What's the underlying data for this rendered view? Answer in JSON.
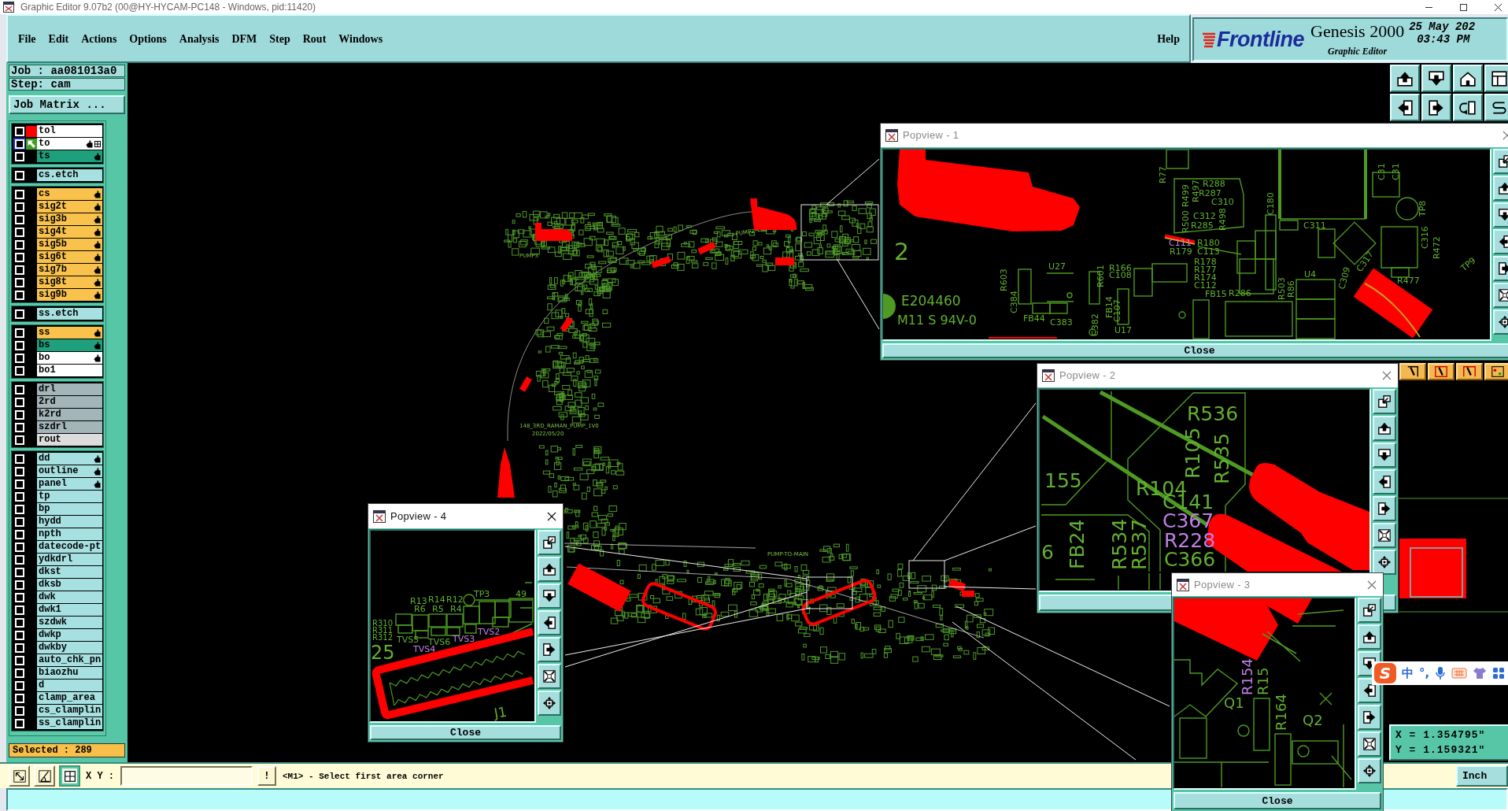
{
  "window": {
    "title": "Graphic Editor 9.07b2 (00@HY-HYCAM-PC148 - Windows, pid:11420)"
  },
  "menu": {
    "items": [
      "File",
      "Edit",
      "Actions",
      "Options",
      "Analysis",
      "DFM",
      "Step",
      "Rout",
      "Windows"
    ],
    "help": "Help"
  },
  "brand": {
    "logo": "Frontline",
    "product": "Genesis 2000",
    "subtitle": "Graphic Editor",
    "date": "25 May 202",
    "time": "03:43 PM"
  },
  "job_panel": {
    "job": "Job : aa081013a0",
    "step": "Step: cam",
    "matrix_button": "Job Matrix ..."
  },
  "layer_groups": [
    {
      "layers": [
        {
          "name": "tol",
          "kind": "silk_screen",
          "color": "#ff0000",
          "work": false,
          "checked": false,
          "affected": false
        },
        {
          "name": "to",
          "kind": "silk_screen",
          "color": "#3f9f22",
          "work": true,
          "checked": false,
          "affected": true
        },
        {
          "name": "ts",
          "kind": "solder_mask",
          "work": false,
          "checked": false,
          "affected": true
        }
      ]
    },
    {
      "layers": [
        {
          "name": "cs.etch",
          "kind": "document",
          "work": false,
          "checked": false,
          "affected": false
        }
      ]
    },
    {
      "layers": [
        {
          "name": "cs",
          "kind": "signal",
          "work": false,
          "checked": false,
          "affected": true
        },
        {
          "name": "sig2t",
          "kind": "signal",
          "work": false,
          "checked": false,
          "affected": true
        },
        {
          "name": "sig3b",
          "kind": "signal",
          "work": false,
          "checked": false,
          "affected": true
        },
        {
          "name": "sig4t",
          "kind": "signal",
          "work": false,
          "checked": false,
          "affected": true
        },
        {
          "name": "sig5b",
          "kind": "signal",
          "work": false,
          "checked": false,
          "affected": true
        },
        {
          "name": "sig6t",
          "kind": "signal",
          "work": false,
          "checked": false,
          "affected": true
        },
        {
          "name": "sig7b",
          "kind": "signal",
          "work": false,
          "checked": false,
          "affected": true
        },
        {
          "name": "sig8t",
          "kind": "signal",
          "work": false,
          "checked": false,
          "affected": true
        },
        {
          "name": "sig9b",
          "kind": "signal",
          "work": false,
          "checked": false,
          "affected": true
        }
      ]
    },
    {
      "layers": [
        {
          "name": "ss.etch",
          "kind": "document",
          "work": false,
          "checked": false,
          "affected": false
        }
      ]
    },
    {
      "layers": [
        {
          "name": "ss",
          "kind": "signal",
          "work": false,
          "checked": false,
          "affected": true
        },
        {
          "name": "bs",
          "kind": "solder_mask",
          "work": false,
          "checked": false,
          "affected": true
        },
        {
          "name": "bo",
          "kind": "silk_screen",
          "work": false,
          "checked": false,
          "affected": true
        },
        {
          "name": "bo1",
          "kind": "silk_screen",
          "work": false,
          "checked": false,
          "affected": false
        }
      ]
    },
    {
      "layers": [
        {
          "name": "drl",
          "kind": "drill",
          "work": false,
          "checked": false,
          "affected": false
        },
        {
          "name": "2rd",
          "kind": "drill",
          "work": false,
          "checked": false,
          "affected": false
        },
        {
          "name": "k2rd",
          "kind": "drill",
          "work": false,
          "checked": false,
          "affected": false
        },
        {
          "name": "szdrl",
          "kind": "drill",
          "work": false,
          "checked": false,
          "affected": false
        },
        {
          "name": "rout",
          "kind": "rout",
          "work": false,
          "checked": false,
          "affected": false
        }
      ]
    },
    {
      "layers": [
        {
          "name": "dd",
          "kind": "document",
          "work": false,
          "checked": false,
          "affected": true
        },
        {
          "name": "outline",
          "kind": "document",
          "work": false,
          "checked": false,
          "affected": true
        },
        {
          "name": "panel",
          "kind": "document",
          "work": false,
          "checked": false,
          "affected": true
        },
        {
          "name": "tp",
          "kind": "document",
          "work": false,
          "checked": false,
          "affected": false
        },
        {
          "name": "bp",
          "kind": "document",
          "work": false,
          "checked": false,
          "affected": false
        },
        {
          "name": "hydd",
          "kind": "document",
          "work": false,
          "checked": false,
          "affected": false
        },
        {
          "name": "npth",
          "kind": "document",
          "work": false,
          "checked": false,
          "affected": false
        },
        {
          "name": "datecode-pt",
          "kind": "document",
          "work": false,
          "checked": false,
          "affected": false
        },
        {
          "name": "ydkdrl",
          "kind": "document",
          "work": false,
          "checked": false,
          "affected": false
        },
        {
          "name": "dkst",
          "kind": "document",
          "work": false,
          "checked": false,
          "affected": false
        },
        {
          "name": "dksb",
          "kind": "document",
          "work": false,
          "checked": false,
          "affected": false
        },
        {
          "name": "dwk",
          "kind": "document",
          "work": false,
          "checked": false,
          "affected": false
        },
        {
          "name": "dwk1",
          "kind": "document",
          "work": false,
          "checked": false,
          "affected": false
        },
        {
          "name": "szdwk",
          "kind": "document",
          "work": false,
          "checked": false,
          "affected": false
        },
        {
          "name": "dwkp",
          "kind": "document",
          "work": false,
          "checked": false,
          "affected": false
        },
        {
          "name": "dwkby",
          "kind": "document",
          "work": false,
          "checked": false,
          "affected": false
        },
        {
          "name": "auto_chk_pn",
          "kind": "document",
          "work": false,
          "checked": false,
          "affected": false
        },
        {
          "name": "biaozhu",
          "kind": "document",
          "work": false,
          "checked": false,
          "affected": false
        },
        {
          "name": "d",
          "kind": "document",
          "work": false,
          "checked": false,
          "affected": false
        },
        {
          "name": "clamp_area",
          "kind": "document",
          "work": false,
          "checked": false,
          "affected": false
        },
        {
          "name": "cs_clamplin",
          "kind": "document",
          "work": false,
          "checked": false,
          "affected": false
        },
        {
          "name": "ss_clamplin",
          "kind": "document",
          "work": false,
          "checked": false,
          "affected": false
        }
      ]
    }
  ],
  "selection": "Selected : 289",
  "canvas": {
    "labels": [
      "PUMP2",
      "PUMP3",
      "148_3RD_RAMAN_PUMP_1V0",
      "2022/05/20",
      "PUMP-TO-MAIN"
    ]
  },
  "popviews": [
    {
      "title": "Popview - 1",
      "active": false,
      "close_label": "Close",
      "labels": [
        {
          "text": "2",
          "highlighted": false
        },
        {
          "text": "E204460",
          "highlighted": false
        },
        {
          "text": "M11 S 94V-0",
          "highlighted": false
        },
        {
          "text": "R77",
          "highlighted": false
        },
        {
          "text": "R499",
          "highlighted": false
        },
        {
          "text": "R288",
          "highlighted": false
        },
        {
          "text": "R497",
          "highlighted": false
        },
        {
          "text": "R287",
          "highlighted": false
        },
        {
          "text": "C310",
          "highlighted": false
        },
        {
          "text": "R500",
          "highlighted": false
        },
        {
          "text": "C312",
          "highlighted": false
        },
        {
          "text": "R498",
          "highlighted": false
        },
        {
          "text": "R285",
          "highlighted": false
        },
        {
          "text": "C180",
          "highlighted": false
        },
        {
          "text": "C311",
          "highlighted": false
        },
        {
          "text": "C31",
          "highlighted": false
        },
        {
          "text": "C31",
          "highlighted": false
        },
        {
          "text": "TP8",
          "highlighted": false
        },
        {
          "text": "C316",
          "highlighted": false
        },
        {
          "text": "R472",
          "highlighted": false
        },
        {
          "text": "C317",
          "highlighted": false
        },
        {
          "text": "R477",
          "highlighted": false
        },
        {
          "text": "TP9",
          "highlighted": false
        },
        {
          "text": "U27",
          "highlighted": false
        },
        {
          "text": "R603",
          "highlighted": false
        },
        {
          "text": "C384",
          "highlighted": false
        },
        {
          "text": "FB44",
          "highlighted": false
        },
        {
          "text": "C383",
          "highlighted": false
        },
        {
          "text": "R166",
          "highlighted": false
        },
        {
          "text": "C108",
          "highlighted": false
        },
        {
          "text": "R601",
          "highlighted": false
        },
        {
          "text": "C382",
          "highlighted": false
        },
        {
          "text": "FB14",
          "highlighted": false
        },
        {
          "text": "C107",
          "highlighted": false
        },
        {
          "text": "U17",
          "highlighted": false
        },
        {
          "text": "C111",
          "highlighted": true
        },
        {
          "text": "R180",
          "highlighted": false
        },
        {
          "text": "R179",
          "highlighted": false
        },
        {
          "text": "C113",
          "highlighted": false
        },
        {
          "text": "R178",
          "highlighted": false
        },
        {
          "text": "R177",
          "highlighted": false
        },
        {
          "text": "R174",
          "highlighted": false
        },
        {
          "text": "C112",
          "highlighted": false
        },
        {
          "text": "FB15",
          "highlighted": false
        },
        {
          "text": "R286",
          "highlighted": false
        },
        {
          "text": "R503",
          "highlighted": false
        },
        {
          "text": "R86",
          "highlighted": false
        },
        {
          "text": "U4",
          "highlighted": false
        },
        {
          "text": "C309",
          "highlighted": false
        }
      ]
    },
    {
      "title": "Popview - 2",
      "active": false,
      "labels": [
        {
          "text": "R536",
          "highlighted": false
        },
        {
          "text": "R105",
          "highlighted": false
        },
        {
          "text": "R535",
          "highlighted": false
        },
        {
          "text": "155",
          "highlighted": false
        },
        {
          "text": "R104",
          "highlighted": false
        },
        {
          "text": "C141",
          "highlighted": false
        },
        {
          "text": "C367",
          "highlighted": true
        },
        {
          "text": "R228",
          "highlighted": true
        },
        {
          "text": "C366",
          "highlighted": false
        },
        {
          "text": "6",
          "highlighted": false
        },
        {
          "text": "FB24",
          "highlighted": false
        },
        {
          "text": "R534",
          "highlighted": false
        },
        {
          "text": "R537",
          "highlighted": false
        }
      ]
    },
    {
      "title": "Popview - 3",
      "active": false,
      "close_label": "Close",
      "labels": [
        {
          "text": "R154",
          "highlighted": true
        },
        {
          "text": "R15",
          "highlighted": false
        },
        {
          "text": "R164",
          "highlighted": false
        },
        {
          "text": "Q1",
          "highlighted": false
        },
        {
          "text": "Q2",
          "highlighted": false
        }
      ]
    },
    {
      "title": "Popview - 4",
      "active": true,
      "close_label": "Close",
      "labels": [
        {
          "text": "TP3",
          "highlighted": false
        },
        {
          "text": "49",
          "highlighted": false
        },
        {
          "text": "R13",
          "highlighted": false
        },
        {
          "text": "R14",
          "highlighted": false
        },
        {
          "text": "R12",
          "highlighted": false
        },
        {
          "text": "R6",
          "highlighted": false
        },
        {
          "text": "R5",
          "highlighted": false
        },
        {
          "text": "R4",
          "highlighted": false
        },
        {
          "text": "R310",
          "highlighted": false
        },
        {
          "text": "R311",
          "highlighted": false
        },
        {
          "text": "TVS2",
          "highlighted": true
        },
        {
          "text": "R312",
          "highlighted": false
        },
        {
          "text": "TVS5",
          "highlighted": false
        },
        {
          "text": "TVS3",
          "highlighted": true
        },
        {
          "text": "TVS6",
          "highlighted": false
        },
        {
          "text": "TVS4",
          "highlighted": true
        },
        {
          "text": "25",
          "highlighted": false
        },
        {
          "text": "J1",
          "highlighted": false
        }
      ]
    }
  ],
  "command_bar": {
    "tool_buttons": [
      {
        "selected": false
      },
      {
        "selected": false
      },
      {
        "selected": true
      }
    ],
    "xy_label": "X Y :",
    "run_button": "!",
    "message": "<M1> - Select first area corner",
    "units": "Inch"
  },
  "coordinates": {
    "x": "X = 1.354795\"",
    "y": "Y = 1.159321\""
  },
  "input_method_bar": {
    "logo": "S",
    "mode": "中",
    "punctuation": "°,"
  }
}
